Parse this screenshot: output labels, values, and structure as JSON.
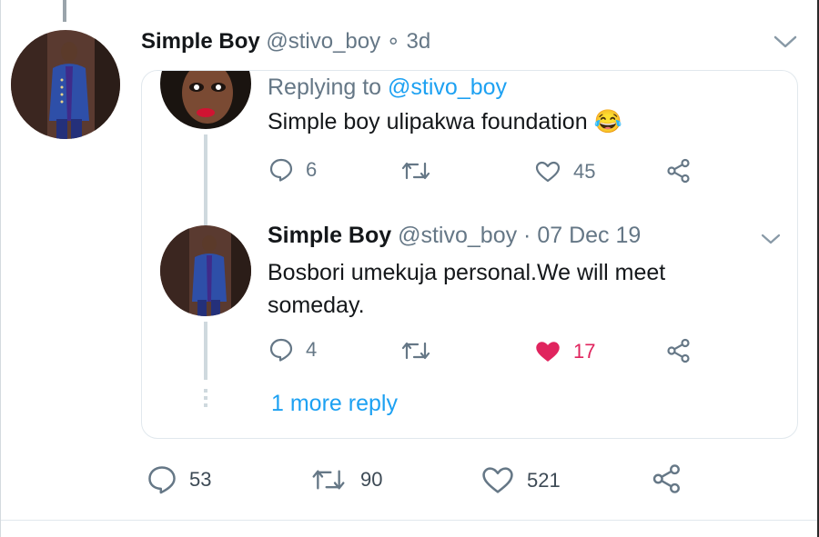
{
  "main_tweet": {
    "author_name": "Simple Boy",
    "handle_and_time": "@stivo_boy ∘ 3d",
    "actions": {
      "replies": "53",
      "retweets": "90",
      "likes": "521"
    }
  },
  "reply_card": {
    "replying_to_prefix": "Replying to",
    "replying_to_handle": "@stivo_boy",
    "text": "Simple boy ulipakwa foundation 😂",
    "actions": {
      "replies": "6",
      "likes": "45"
    }
  },
  "nested_reply": {
    "author_name": "Simple Boy",
    "handle_and_date": "@stivo_boy · 07 Dec 19",
    "text_line1": "Bosbori umekuja personal.We will meet",
    "text_line2": "someday.",
    "actions": {
      "replies": "4",
      "likes": "17",
      "liked": true
    }
  },
  "more_replies_label": "1 more reply",
  "colors": {
    "accent_blue": "#1da1f2",
    "like_red": "#e0245e",
    "muted": "#657786",
    "border": "#e1e8ed"
  }
}
